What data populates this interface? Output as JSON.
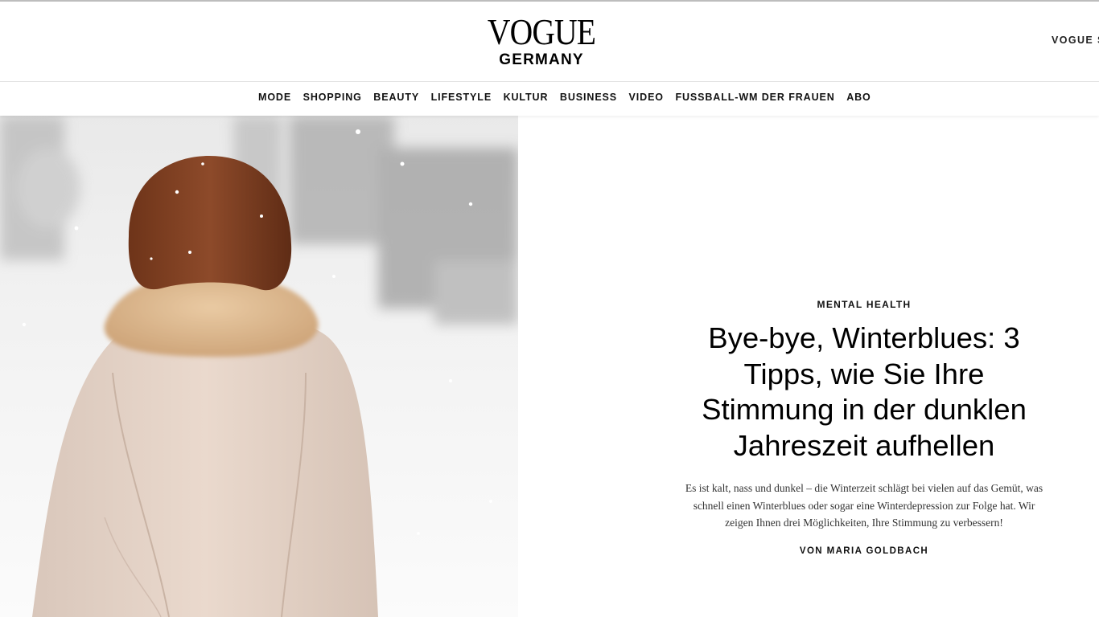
{
  "masthead": {
    "logo_main": "VOGUE",
    "logo_country": "GERMANY",
    "edition_link": "VOGUE S"
  },
  "nav": {
    "items": [
      {
        "label": "MODE"
      },
      {
        "label": "SHOPPING"
      },
      {
        "label": "BEAUTY"
      },
      {
        "label": "LIFESTYLE"
      },
      {
        "label": "KULTUR"
      },
      {
        "label": "BUSINESS"
      },
      {
        "label": "VIDEO"
      },
      {
        "label": "FUSSBALL-WM DER FRAUEN"
      },
      {
        "label": "ABO"
      }
    ]
  },
  "article": {
    "rubric": "MENTAL HEALTH",
    "headline": "Bye-bye, Winterblues: 3 Tipps, wie Sie Ihre Stimmung in der dunklen Jahreszeit aufhellen",
    "dek": "Es ist kalt, nass und dunkel – die Winterzeit schlägt bei vielen auf das Gemüt, was schnell einen Winterblues oder sogar eine Winterdepression zur Folge hat. Wir zeigen Ihnen drei Möglichkeiten, Ihre Stimmung zu verbessern!",
    "byline": "VON MARIA GOLDBACH"
  },
  "hero": {
    "icon": "photo-woman-in-snow",
    "colors": {
      "coat": "#e3d3c8",
      "fur": "#d9b78f",
      "hair": "#7a3f24",
      "snow": "#f4f4f4"
    }
  }
}
